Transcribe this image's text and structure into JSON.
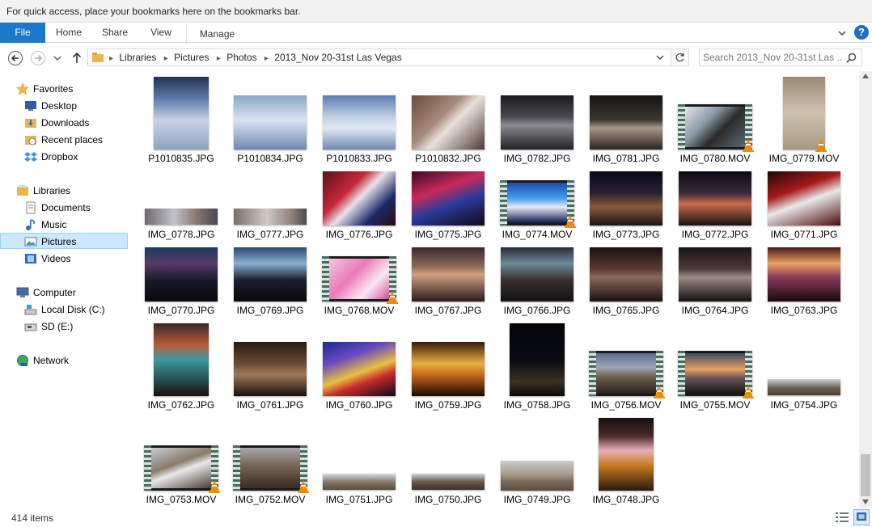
{
  "bookmarks_bar": {
    "text": "For quick access, place your bookmarks here on the bookmarks bar."
  },
  "ribbon": {
    "tabs": [
      "File",
      "Home",
      "Share",
      "View",
      "Manage"
    ],
    "help_label": "?"
  },
  "address": {
    "crumbs": [
      "Libraries",
      "Pictures",
      "Photos",
      "2013_Nov 20-31st Las Vegas"
    ]
  },
  "search": {
    "placeholder": "Search 2013_Nov 20-31st Las ..."
  },
  "nav": {
    "favorites": {
      "label": "Favorites",
      "items": [
        "Desktop",
        "Downloads",
        "Recent places",
        "Dropbox"
      ]
    },
    "libraries": {
      "label": "Libraries",
      "items": [
        "Documents",
        "Music",
        "Pictures",
        "Videos"
      ]
    },
    "computer": {
      "label": "Computer",
      "items": [
        "Local Disk (C:)",
        "SD (E:)"
      ]
    },
    "network": {
      "label": "Network"
    }
  },
  "files": [
    "P1010835.JPG",
    "P1010834.JPG",
    "P1010833.JPG",
    "P1010832.JPG",
    "IMG_0782.JPG",
    "IMG_0781.JPG",
    "IMG_0780.MOV",
    "IMG_0779.MOV",
    "IMG_0778.JPG",
    "IMG_0777.JPG",
    "IMG_0776.JPG",
    "IMG_0775.JPG",
    "IMG_0774.MOV",
    "IMG_0773.JPG",
    "IMG_0772.JPG",
    "IMG_0771.JPG",
    "IMG_0770.JPG",
    "IMG_0769.JPG",
    "IMG_0768.MOV",
    "IMG_0767.JPG",
    "IMG_0766.JPG",
    "IMG_0765.JPG",
    "IMG_0764.JPG",
    "IMG_0763.JPG",
    "IMG_0762.JPG",
    "IMG_0761.JPG",
    "IMG_0760.JPG",
    "IMG_0759.JPG",
    "IMG_0758.JPG",
    "IMG_0756.MOV",
    "IMG_0755.MOV",
    "IMG_0754.JPG",
    "IMG_0753.MOV",
    "IMG_0752.MOV",
    "IMG_0751.JPG",
    "IMG_0750.JPG",
    "IMG_0749.JPG",
    "IMG_0748.JPG"
  ],
  "status": {
    "item_count": "414 items"
  },
  "colors": {
    "accent": "#1979ca",
    "selection": "#cce8ff"
  }
}
